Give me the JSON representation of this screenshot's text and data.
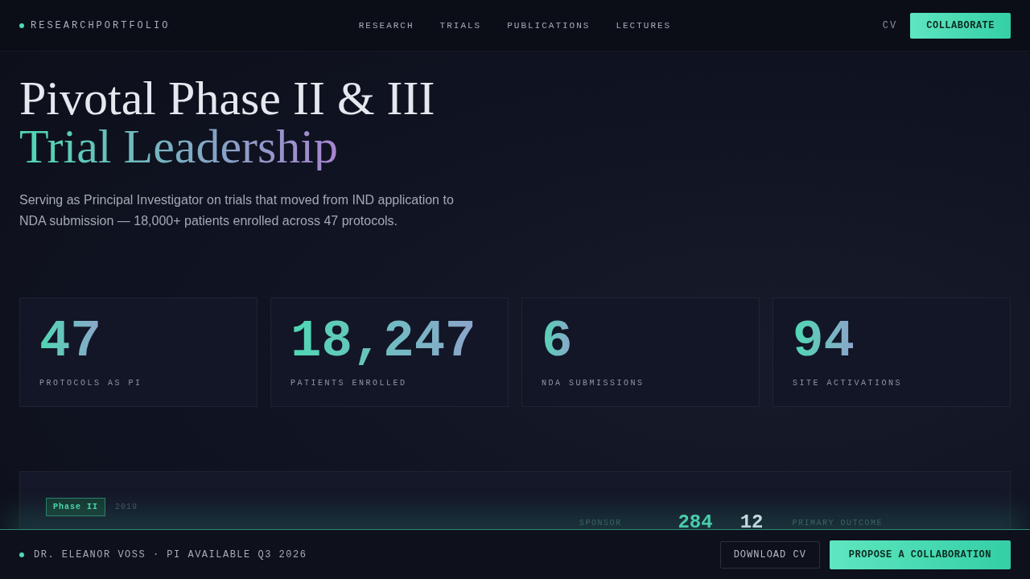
{
  "nav": {
    "brand": "RESEARCHPORTFOLIO",
    "links": [
      {
        "label": "RESEARCH"
      },
      {
        "label": "TRIALS"
      },
      {
        "label": "PUBLICATIONS"
      },
      {
        "label": "LECTURES"
      }
    ],
    "cv": "CV",
    "cta": "COLLABORATE"
  },
  "hero": {
    "title_line1": "Pivotal Phase II & III",
    "title_line2": "Trial Leadership",
    "lede": "Serving as Principal Investigator on trials that moved from IND application to NDA submission — 18,000+ patients enrolled across 47 protocols."
  },
  "stats": [
    {
      "value": "47",
      "label": "PROTOCOLS AS PI"
    },
    {
      "value": "18,247",
      "label": "PATIENTS ENROLLED"
    },
    {
      "value": "6",
      "label": "NDA SUBMISSIONS"
    },
    {
      "value": "94",
      "label": "SITE ACTIVATIONS"
    }
  ],
  "trial": {
    "phase": "Phase II",
    "year": "2019",
    "sponsor_label": "SPONSOR",
    "enrolled": "284",
    "sites": "12",
    "outcome_label": "PRIMARY OUTCOME"
  },
  "footer": {
    "status": "DR. ELEANOR VOSS · PI AVAILABLE Q3 2026",
    "secondary": "DOWNLOAD CV",
    "primary": "PROPOSE A COLLABORATION"
  }
}
